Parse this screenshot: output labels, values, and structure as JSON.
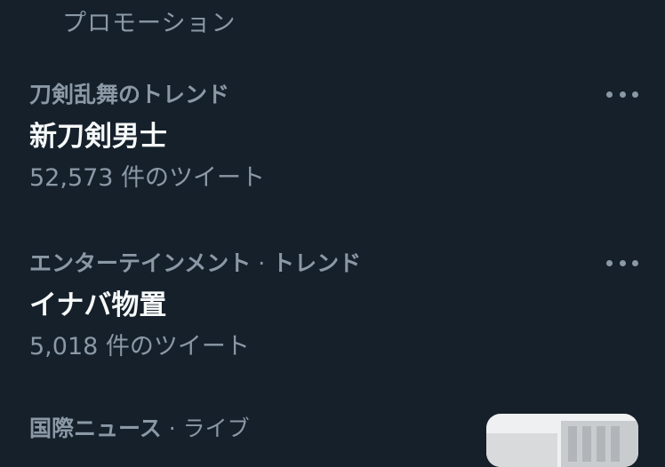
{
  "promotion_label": "プロモーション",
  "trends": [
    {
      "context": "刀剣乱舞のトレンド",
      "title": "新刀剣男士",
      "count": "52,573 件のツイート"
    },
    {
      "context": "エンターテインメント",
      "separator": " · ",
      "context_suffix": "トレンド",
      "title": "イナバ物置",
      "count": "5,018 件のツイート"
    },
    {
      "context": "国際ニュース",
      "separator": " · ",
      "context_suffix": "ライブ"
    }
  ],
  "colors": {
    "background": "#15202b",
    "primary_text": "#f7f9f9",
    "secondary_text": "#8b98a5"
  },
  "icons": {
    "more": "more-horizontal-icon"
  }
}
